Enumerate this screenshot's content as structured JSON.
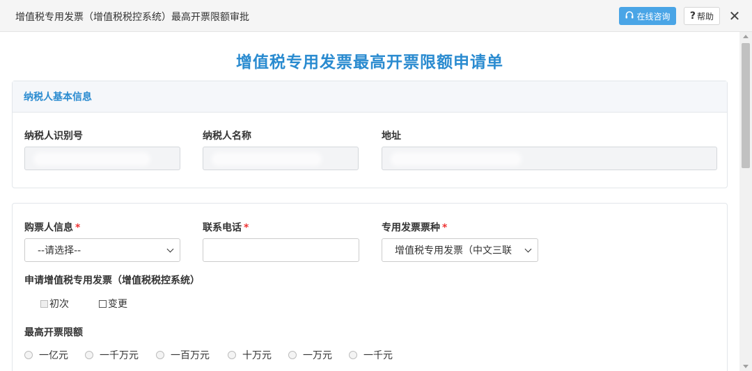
{
  "window": {
    "title": "增值税专用发票（增值税税控系统）最高开票限额审批",
    "consult_label": "在线咨询",
    "help_label": "帮助",
    "close_glyph": "✕"
  },
  "form": {
    "title": "增值税专用发票最高开票限额申请单",
    "taxpayer_section": {
      "heading": "纳税人基本信息",
      "fields": [
        {
          "label": "纳税人识别号",
          "value": ""
        },
        {
          "label": "纳税人名称",
          "value": ""
        },
        {
          "label": "地址",
          "value": ""
        }
      ]
    },
    "purchaser_label": "购票人信息",
    "purchaser_value": "--请选择--",
    "phone_label": "联系电话",
    "phone_value": "",
    "invoice_type_label": "专用发票票种",
    "invoice_type_value": "增值税专用发票（中文三联",
    "required_mark": "*",
    "apply_label": "申请增值税专用发票（增值税税控系统）",
    "apply_options": [
      {
        "label": "初次",
        "checked": false,
        "disabled": true
      },
      {
        "label": "变更",
        "checked": false,
        "disabled": false
      }
    ],
    "limit_label": "最高开票限额",
    "limit_options": [
      "一亿元",
      "一千万元",
      "一百万元",
      "十万元",
      "一万元",
      "一千元"
    ]
  },
  "colors": {
    "accent": "#2a8bd0",
    "consult_button": "#4aa5e6",
    "required": "#e33333"
  },
  "icons": {
    "consult": "headset-icon",
    "help": "question-icon",
    "close": "close-icon",
    "dropdown": "chevron-down-icon"
  }
}
